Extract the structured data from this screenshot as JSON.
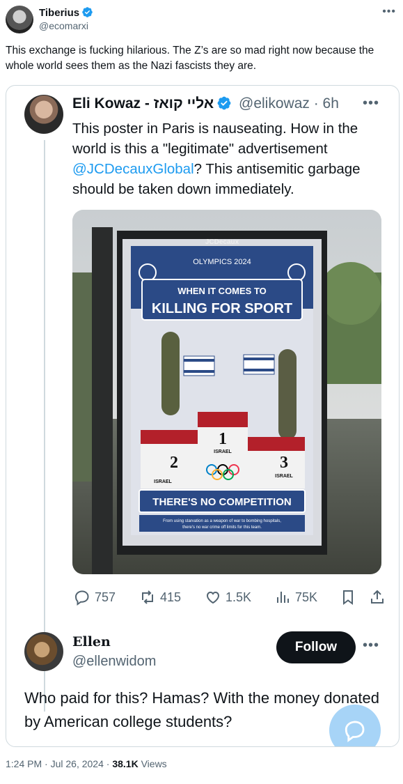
{
  "author": {
    "name": "Tiberius",
    "handle": "@ecomarxi"
  },
  "tweet_text": "This exchange is fucking hilarious. The Z’s are so mad right now because the whole world sees them as the Nazi fascists they are.",
  "quoted": {
    "name": "Eli Kowaz - אליי קואז",
    "handle": "@elikowaz",
    "time": "6h",
    "text_before": "This poster in Paris is nauseating. How in the world is this a \"legitimate\" advertisement ",
    "mention": "@JCDecauxGlobal",
    "text_after": "? This antisemitic garbage should be taken down immediately.",
    "poster": {
      "brand": "JCDecaux",
      "event": "OLYMPICS 2024",
      "headline_1": "WHEN IT COMES TO",
      "headline_2": "KILLING FOR SPORT",
      "podium_1": "1",
      "podium_2": "2",
      "podium_3": "3",
      "country_label": "ISRAEL",
      "banner": "THERE'S NO COMPETITION",
      "subtext_1": "From using starvation as a weapon of war to bombing hospitals,",
      "subtext_2": "there's no war crime off limits for this team."
    },
    "stats": {
      "replies": "757",
      "reposts": "415",
      "likes": "1.5K",
      "views": "75K"
    }
  },
  "reply": {
    "name": "Ellen",
    "handle": "@ellenwidom",
    "follow_label": "Follow",
    "text": "Who paid for this? Hamas? With the money donated by American college students?"
  },
  "meta": {
    "time": "1:24 PM",
    "date": "Jul 26, 2024",
    "views_count": "38.1K",
    "views_label": "Views"
  },
  "colors": {
    "verified": "#1d9bf0",
    "link": "#1d9bf0",
    "text": "#0f1419",
    "muted": "#536471",
    "border": "#cfd9de",
    "poster_blue": "#2b4a86",
    "poster_red": "#b3202a"
  }
}
